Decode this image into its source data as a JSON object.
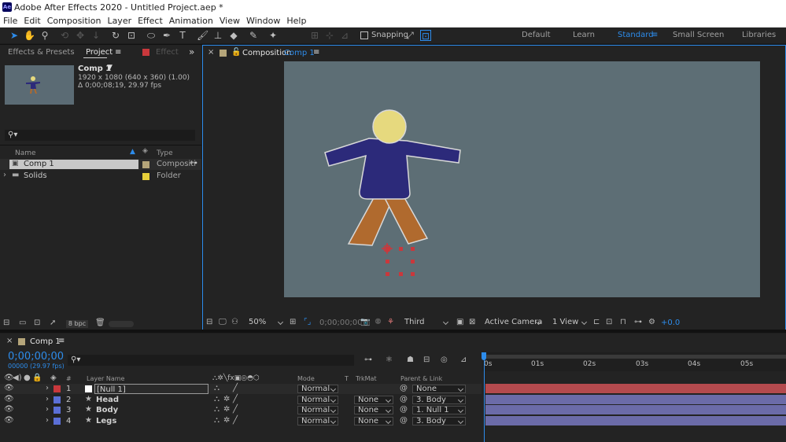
{
  "window": {
    "title": "Adobe After Effects 2020 - Untitled Project.aep *",
    "app_icon": "Ae"
  },
  "menu": [
    "File",
    "Edit",
    "Composition",
    "Layer",
    "Effect",
    "Animation",
    "View",
    "Window",
    "Help"
  ],
  "toolbar": {
    "snapping_label": "Snapping"
  },
  "workspaces": [
    "Default",
    "Learn",
    "Standard",
    "Small Screen",
    "Libraries"
  ],
  "project_panel": {
    "tabs": {
      "effects": "Effects & Presets",
      "project": "Project",
      "effect_controls": "Effect"
    },
    "comp_name": "Comp 1",
    "comp_info_1": "1920 x 1080  (640 x 360) (1.00)",
    "comp_info_2": "Δ 0;00;08;19, 29.97 fps",
    "search_placeholder": "",
    "col_name": "Name",
    "col_type": "Type",
    "items": [
      {
        "name": "Comp 1",
        "type": "Compositi",
        "color": "#b5a57a"
      },
      {
        "name": "Solids",
        "type": "Folder",
        "color": "#e6cf3a"
      }
    ],
    "bpc": "8 bpc"
  },
  "viewer": {
    "tab_prefix": "Composition",
    "tab_name": "Comp 1",
    "zoom": "50%",
    "timecode": "0;00;00;00",
    "resolution": "Third",
    "camera": "Active Camera",
    "views": "1 View",
    "exposure": "+0.0"
  },
  "timeline": {
    "tab_name": "Comp 1",
    "timecode": "0;00;00;00",
    "frame_info": "00000 (29.97 fps)",
    "headers": {
      "layer_name": "Layer Name",
      "mode": "Mode",
      "t": "T",
      "trkmat": "TrkMat",
      "parent": "Parent & Link"
    },
    "ruler": [
      "0s",
      "01s",
      "02s",
      "03s",
      "04s",
      "05s"
    ],
    "layers": [
      {
        "num": "1",
        "name": "[Null 1]",
        "color": "#c9383c",
        "mode": "Normal",
        "trkmat": "",
        "parent": "None",
        "bar_color": "#b44a4e"
      },
      {
        "num": "2",
        "name": "Head",
        "color": "#5b6fd6",
        "mode": "Normal",
        "trkmat": "None",
        "parent": "3. Body",
        "bar_color": "#6b6ba8"
      },
      {
        "num": "3",
        "name": "Body",
        "color": "#5b6fd6",
        "mode": "Normal",
        "trkmat": "None",
        "parent": "1. Null 1",
        "bar_color": "#6b6ba8"
      },
      {
        "num": "4",
        "name": "Legs",
        "color": "#5b6fd6",
        "mode": "Normal",
        "trkmat": "None",
        "parent": "3. Body",
        "bar_color": "#6b6ba8"
      }
    ]
  },
  "colors": {
    "accent": "#2d8ceb",
    "panel": "#232323",
    "comp_bg": "#5d6e75",
    "body": "#2c2a7a",
    "head": "#e6d97e",
    "legs": "#b06a2e"
  }
}
